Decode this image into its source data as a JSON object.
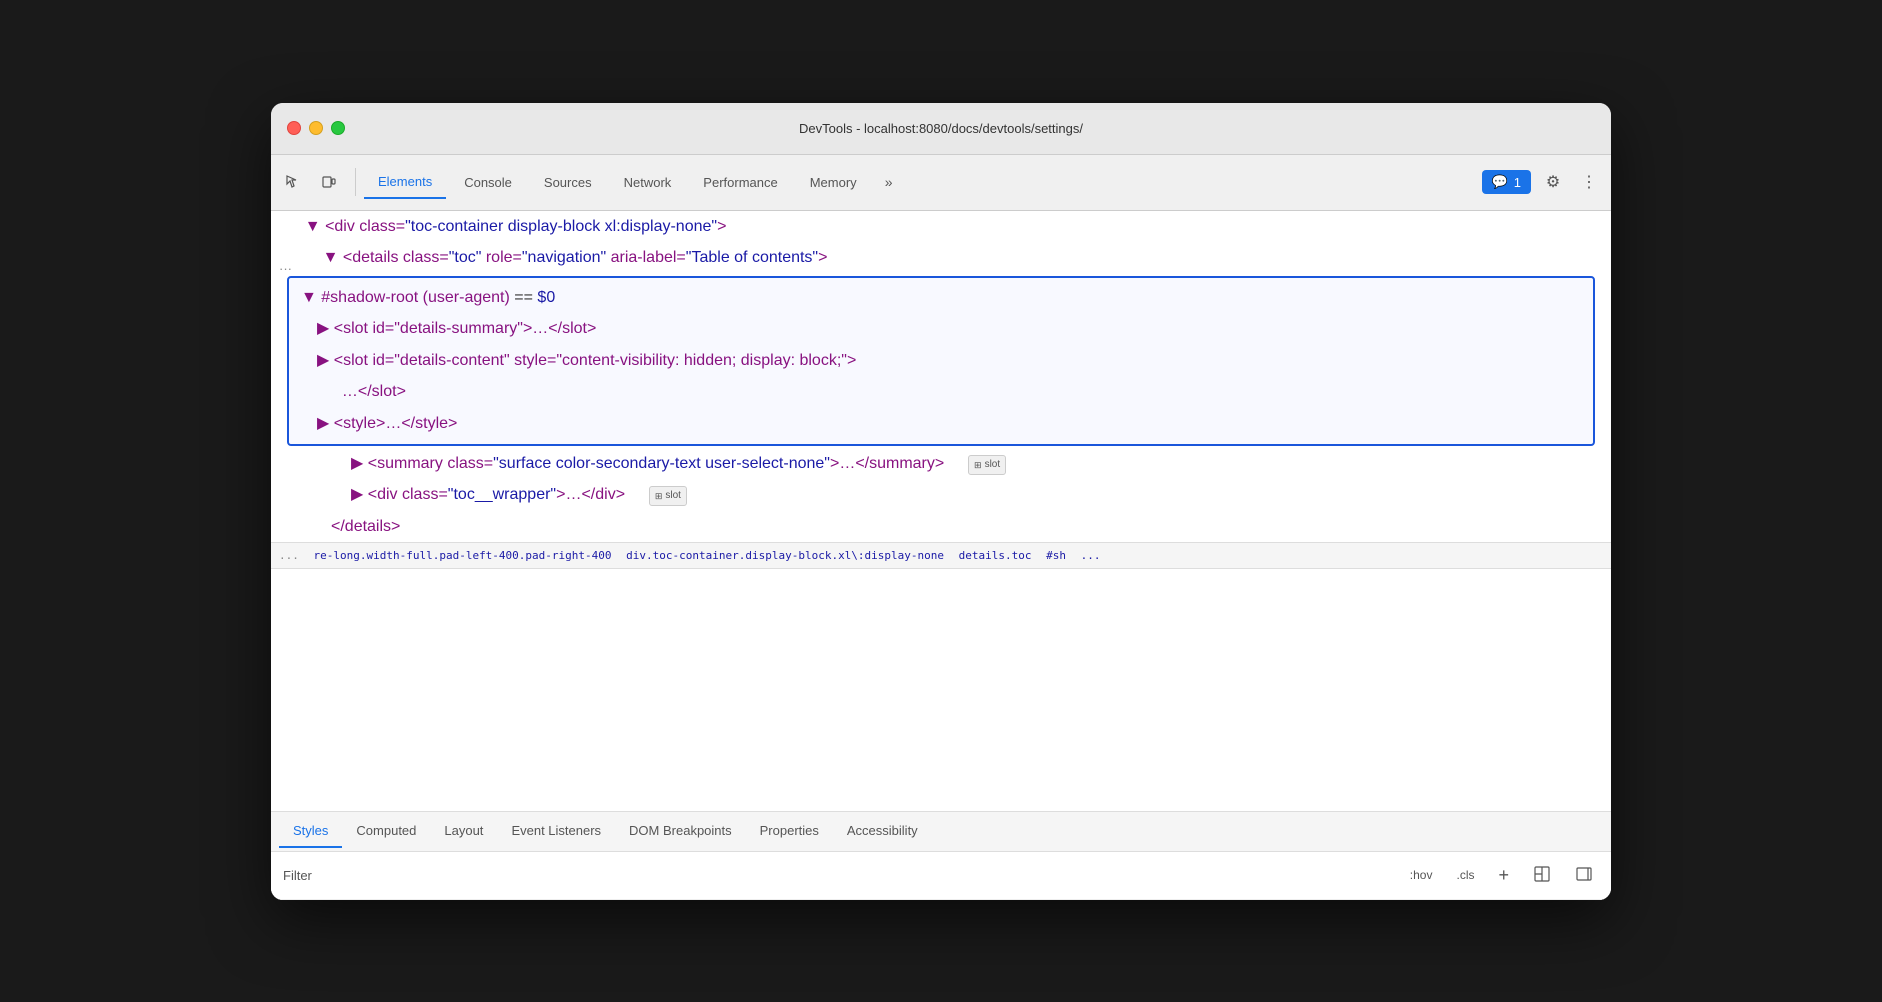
{
  "window": {
    "title": "DevTools - localhost:8080/docs/devtools/settings/"
  },
  "traffic_lights": {
    "close": "close",
    "minimize": "minimize",
    "maximize": "maximize"
  },
  "tabs": {
    "active": "Elements",
    "items": [
      "Elements",
      "Console",
      "Sources",
      "Network",
      "Performance",
      "Memory"
    ]
  },
  "more_tabs": "»",
  "chat_badge": {
    "icon": "💬",
    "count": "1"
  },
  "settings_icon": "⚙",
  "more_menu_icon": "⋮",
  "dom": {
    "line1": "▼ <div class=\"toc-container display-block xl:display-none\">",
    "line2": "▼ <details class=\"toc\" role=\"navigation\" aria-label=\"Table of contents\">",
    "shadow_root_label": "▼ #shadow-root (user-agent)",
    "shadow_root_equals": "==",
    "shadow_root_var": "$0",
    "slot1": "▶ <slot id=\"details-summary\">…</slot>",
    "slot2": "▶ <slot id=\"details-content\" style=\"content-visibility: hidden; display: block;\">",
    "slot2_cont": "…</slot>",
    "style_tag": "▶ <style>…</style>",
    "summary_line": "▶ <summary class=\"surface color-secondary-text user-select-none\">…</summary>",
    "slot_badge1": "slot",
    "div_wrapper": "▶ <div class=\"toc__wrapper\">…</div>",
    "slot_badge2": "slot",
    "end_details": "</details>",
    "ellipsis": "..."
  },
  "breadcrumb": {
    "ellipsis": "...",
    "items": [
      "re-long.width-full.pad-left-400.pad-right-400",
      "div.toc-container.display-block.xl\\:display-none",
      "details.toc",
      "#sh",
      "..."
    ]
  },
  "bottom_tabs": {
    "active": "Styles",
    "items": [
      "Styles",
      "Computed",
      "Layout",
      "Event Listeners",
      "DOM Breakpoints",
      "Properties",
      "Accessibility"
    ]
  },
  "filter": {
    "label": "Filter",
    "hov_btn": ":hov",
    "cls_btn": ".cls",
    "plus_btn": "+",
    "layout_icon": "⊞",
    "sidebar_icon": "→"
  }
}
